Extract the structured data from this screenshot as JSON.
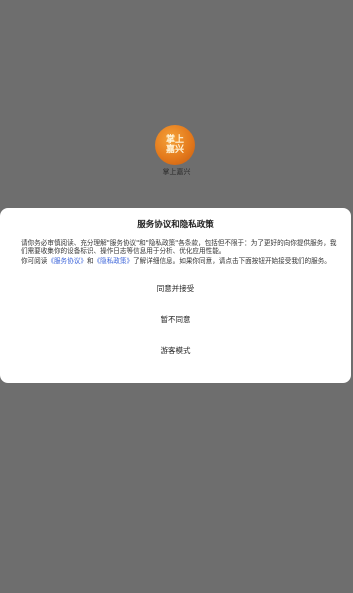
{
  "app": {
    "icon_text_line1": "掌上",
    "icon_text_line2": "嘉兴",
    "name": "掌上嘉兴"
  },
  "dialog": {
    "title": "服务协议和隐私政策",
    "paragraph1": "请你务必审慎阅读、充分理解\"服务协议\"和\"隐私政策\"各条款，包括但不限于：为了更好的向你提供服务，我们需要收集你的设备标识、操作日志等信息用于分析、优化应用性能。",
    "paragraph2_prefix": "你可阅读",
    "service_link": "《服务协议》",
    "and_text": "和",
    "privacy_link": "《隐私政策》",
    "paragraph2_suffix": "了解详细信息。如果你同意，请点击下面按钮开始接受我们的服务。",
    "agree_button": "同意并接受",
    "disagree_button": "暂不同意",
    "guest_button": "游客模式"
  }
}
